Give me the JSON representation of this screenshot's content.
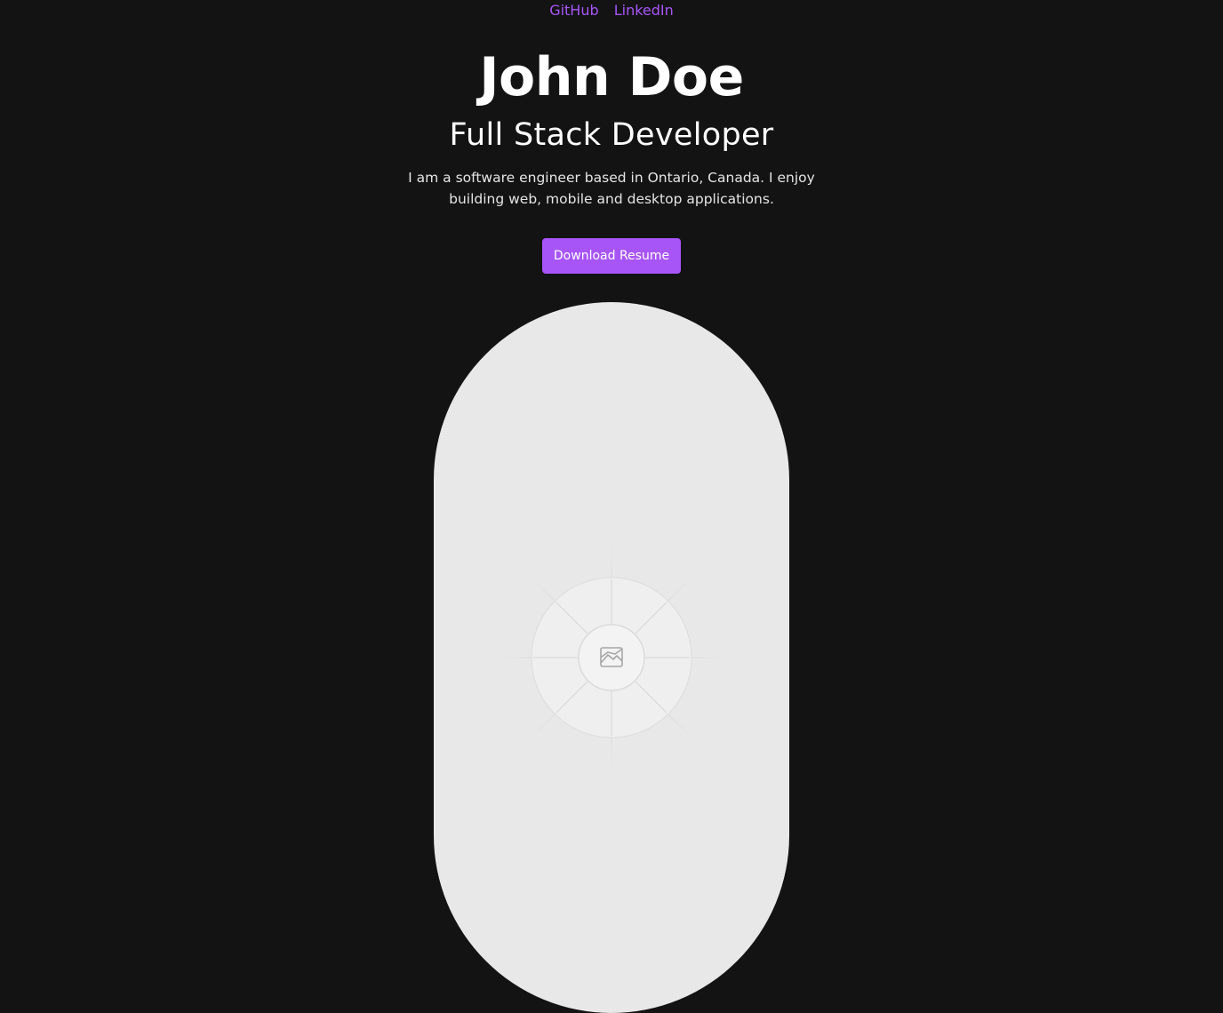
{
  "header": {
    "links": [
      {
        "label": "GitHub"
      },
      {
        "label": "LinkedIn"
      }
    ]
  },
  "hero": {
    "name": "John Doe",
    "role": "Full Stack Developer",
    "bio": "I am a software engineer based in Ontario, Canada. I enjoy building web, mobile and desktop applications.",
    "cta_label": "Download Resume"
  },
  "portrait": {
    "icon": "image-placeholder-icon"
  },
  "colors": {
    "background": "#131313",
    "accent": "#a855f7",
    "text": "#ffffff",
    "placeholder": "#e8e8e8"
  }
}
